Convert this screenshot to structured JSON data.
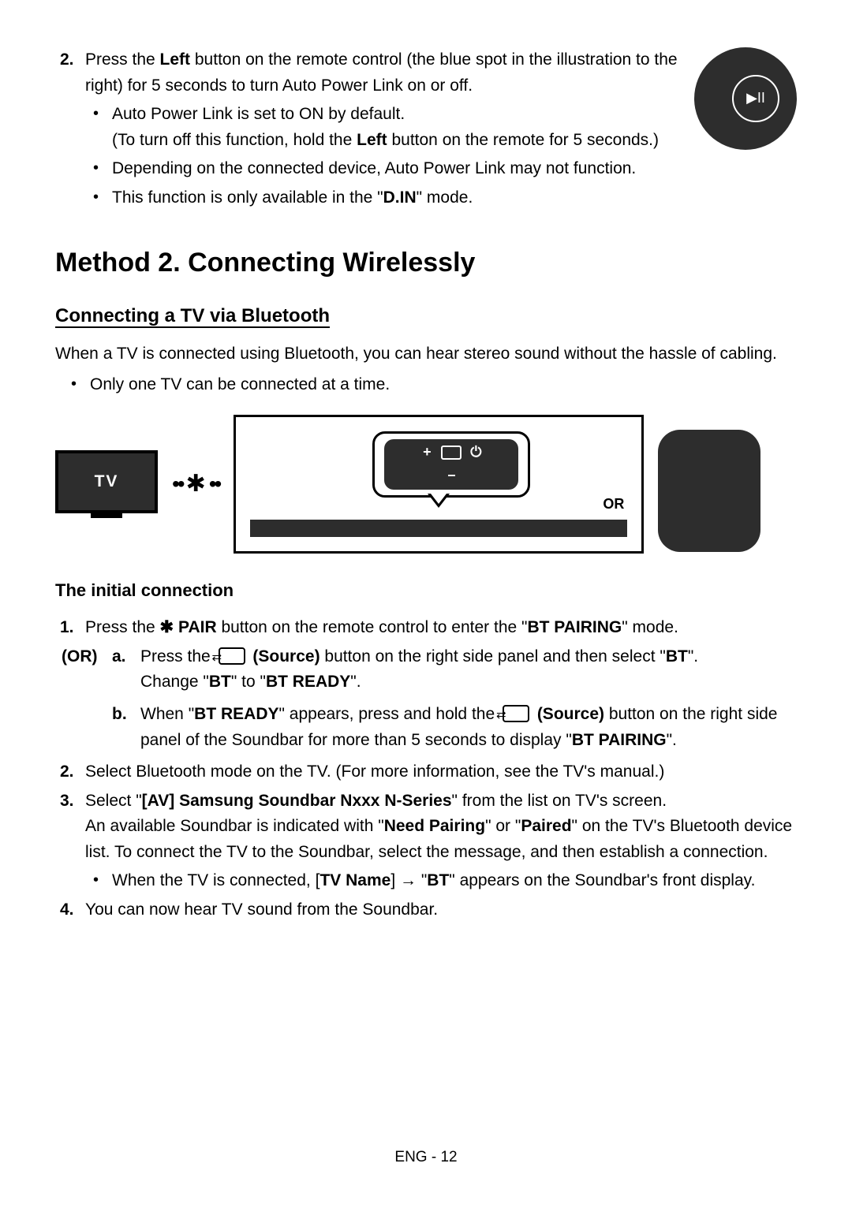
{
  "step2": {
    "number": "2.",
    "text_pre": "Press the ",
    "left_bold": "Left",
    "text_mid": " button on the remote control (the blue spot in the illustration to the right) for 5 seconds to turn Auto Power Link on or off.",
    "bullets": {
      "b1_pre": "Auto Power Link is set to ON by default.",
      "b1_sub_pre": "(To turn off this function, hold the ",
      "b1_sub_bold": "Left",
      "b1_sub_post": " button on the remote for 5 seconds.)",
      "b2": "Depending on the connected device, Auto Power Link may not function.",
      "b3_pre": "This function is only available in the \"",
      "b3_bold": "D.IN",
      "b3_post": "\" mode."
    }
  },
  "section": {
    "title": "Method 2. Connecting Wirelessly",
    "subtitle": "Connecting a TV via Bluetooth",
    "intro": "When a TV is connected using Bluetooth, you can hear stereo sound without the hassle of cabling.",
    "intro_bullet": "Only one TV can be connected at a time.",
    "diagram": {
      "tv_label": "TV",
      "or_label": "OR"
    },
    "h4": "The initial connection"
  },
  "steps": {
    "s1": {
      "num": "1.",
      "pre": "Press the ",
      "icon_name": "bluetooth-icon",
      "pair_bold": " PAIR",
      "mid": " button on the remote control to enter the \"",
      "mode_bold": "BT PAIRING",
      "post": "\" mode."
    },
    "or_label": "(OR)",
    "or_a": {
      "letter": "a.",
      "pre": "Press the ",
      "src_bold": " (Source)",
      "mid": " button on the right side panel and then select \"",
      "bt": "BT",
      "post": "\".",
      "line2_pre": "Change \"",
      "line2_bt": "BT",
      "line2_mid": "\" to \"",
      "line2_ready": "BT READY",
      "line2_post": "\"."
    },
    "or_b": {
      "letter": "b.",
      "pre": "When \"",
      "ready_bold": "BT READY",
      "mid": "\" appears, press and hold the ",
      "src_bold": " (Source)",
      "mid2": " button on the right side panel of the Soundbar for more than 5 seconds to display \"",
      "pair_bold": "BT PAIRING",
      "post": "\"."
    },
    "s2": {
      "num": "2.",
      "text": "Select Bluetooth mode on the TV. (For more information, see the TV's manual.)"
    },
    "s3": {
      "num": "3.",
      "pre": "Select \"",
      "name_bold": "[AV] Samsung Soundbar Nxxx N-Series",
      "mid": "\" from the list on TV's screen.",
      "line2_pre": "An available Soundbar is indicated with \"",
      "need_bold": "Need Pairing",
      "line2_mid": "\" or \"",
      "paired_bold": "Paired",
      "line2_post": "\" on the TV's Bluetooth device list. To connect the TV to the Soundbar, select the message, and then establish a connection.",
      "bullet_pre": "When the TV is connected, [",
      "tv_name": "TV Name",
      "bullet_mid": "] → \"",
      "bt": "BT",
      "bullet_post": "\" appears on the Soundbar's front display."
    },
    "s4": {
      "num": "4.",
      "text": "You can now hear TV sound from the Soundbar."
    }
  },
  "footer": "ENG - 12"
}
